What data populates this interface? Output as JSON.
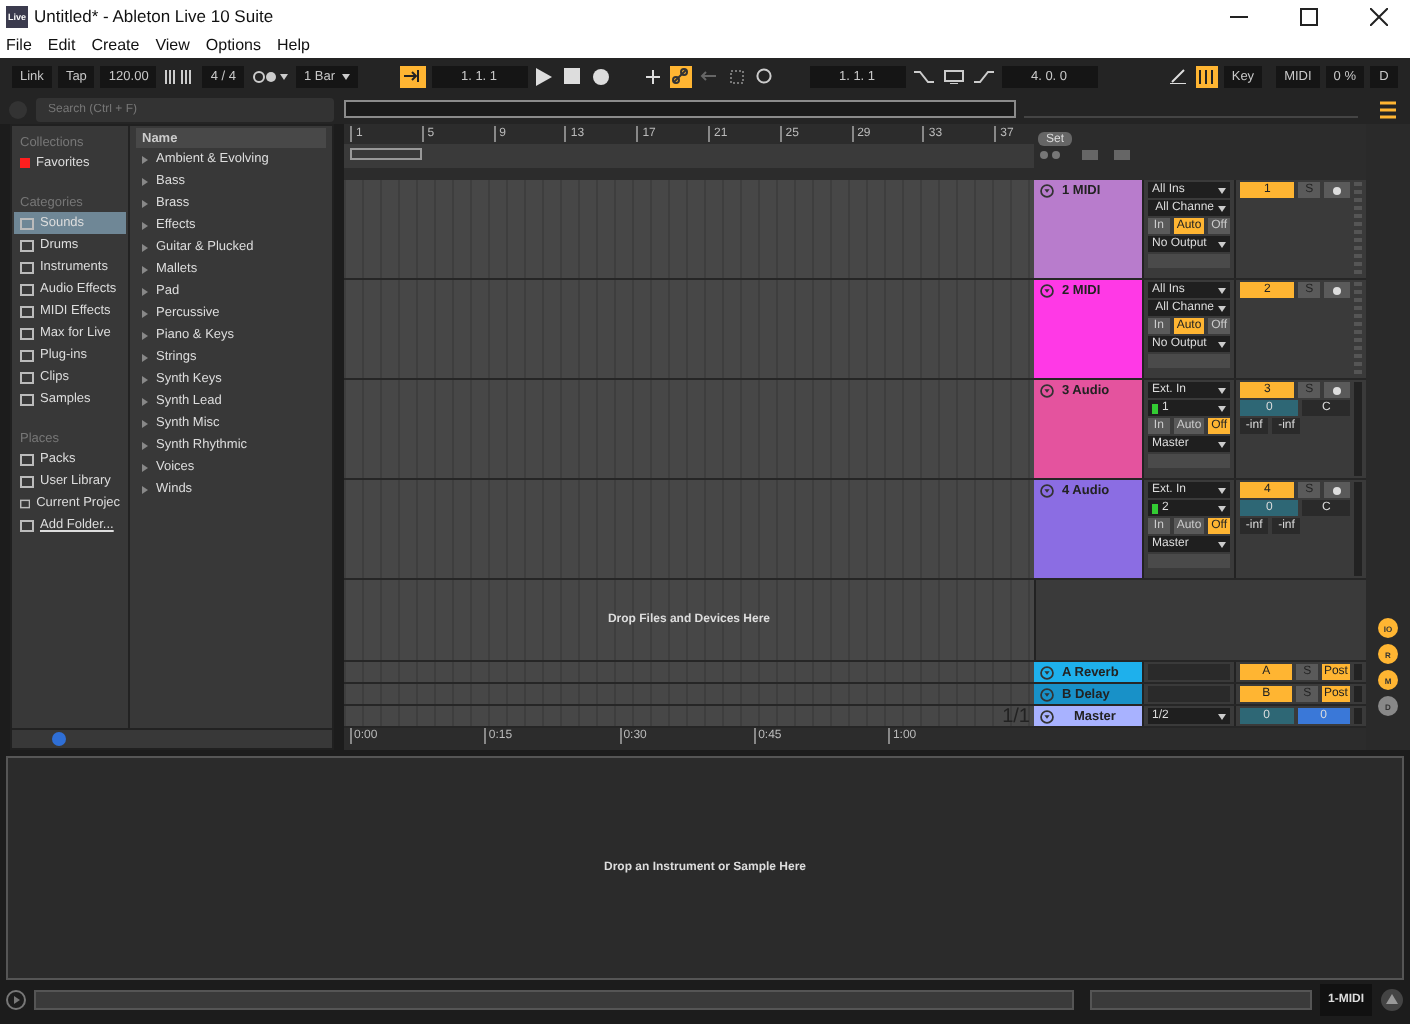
{
  "window": {
    "app_icon_text": "Live",
    "title": "Untitled* - Ableton Live 10 Suite"
  },
  "menu": [
    "File",
    "Edit",
    "Create",
    "View",
    "Options",
    "Help"
  ],
  "control_bar": {
    "link": "Link",
    "tap": "Tap",
    "tempo": "120.00",
    "signature": "4 / 4",
    "quantization": "1 Bar",
    "follow_on": true,
    "position": "1. 1. 1",
    "automation_arm_on": true,
    "loop_start": "1. 1. 1",
    "loop_length": "4. 0. 0",
    "key_map_on": true,
    "key": "Key",
    "midi": "MIDI",
    "cpu": "0 %",
    "disk": "D"
  },
  "browser": {
    "search": {
      "placeholder": "Search (Ctrl + F)"
    },
    "collections_heading": "Collections",
    "collections": [
      {
        "label": "Favorites",
        "color": "#ff1e1e"
      }
    ],
    "categories_heading": "Categories",
    "categories": [
      {
        "label": "Sounds",
        "selected": true
      },
      {
        "label": "Drums",
        "selected": false
      },
      {
        "label": "Instruments",
        "selected": false
      },
      {
        "label": "Audio Effects",
        "selected": false
      },
      {
        "label": "MIDI Effects",
        "selected": false
      },
      {
        "label": "Max for Live",
        "selected": false
      },
      {
        "label": "Plug-ins",
        "selected": false
      },
      {
        "label": "Clips",
        "selected": false
      },
      {
        "label": "Samples",
        "selected": false
      }
    ],
    "places_heading": "Places",
    "places": [
      "Packs",
      "User Library",
      "Current Projec",
      "Add Folder..."
    ],
    "name_heading": "Name",
    "names": [
      "Ambient & Evolving",
      "Bass",
      "Brass",
      "Effects",
      "Guitar & Plucked",
      "Mallets",
      "Pad",
      "Percussive",
      "Piano & Keys",
      "Strings",
      "Synth Keys",
      "Synth Lead",
      "Synth Misc",
      "Synth Rhythmic",
      "Voices",
      "Winds"
    ]
  },
  "arrangement": {
    "bar_ruler": [
      "1",
      "5",
      "9",
      "13",
      "17",
      "21",
      "25",
      "29",
      "33",
      "37"
    ],
    "time_ruler": [
      "0:00",
      "0:15",
      "0:30",
      "0:45",
      "1:00"
    ],
    "drop_text": "Drop Files and Devices Here",
    "zoom": "1/1",
    "set_label": "Set"
  },
  "tracks": [
    {
      "kind": "midi",
      "name": "1 MIDI",
      "color": "#b87ccc",
      "input": "All Ins",
      "channel": "All Channe",
      "monitor": [
        {
          "label": "In",
          "selected": false
        },
        {
          "label": "Auto",
          "selected": true
        },
        {
          "label": "Off",
          "selected": false
        }
      ],
      "output": "No Output",
      "number": "1",
      "solo": "S"
    },
    {
      "kind": "midi",
      "name": "2 MIDI",
      "color": "#ff39e6",
      "input": "All Ins",
      "channel": "All Channe",
      "monitor": [
        {
          "label": "In",
          "selected": false
        },
        {
          "label": "Auto",
          "selected": true
        },
        {
          "label": "Off",
          "selected": false
        }
      ],
      "output": "No Output",
      "number": "2",
      "solo": "S"
    },
    {
      "kind": "audio",
      "name": "3 Audio",
      "color": "#e4539e",
      "input": "Ext. In",
      "channel": "1",
      "monitor": [
        {
          "label": "In",
          "selected": false
        },
        {
          "label": "Auto",
          "selected": false
        },
        {
          "label": "Off",
          "selected": true
        }
      ],
      "output": "Master",
      "number": "3",
      "solo": "S",
      "volume": "0",
      "pan": "C",
      "meter_left": "-inf",
      "meter_right": "-inf"
    },
    {
      "kind": "audio",
      "name": "4 Audio",
      "color": "#8b6de3",
      "input": "Ext. In",
      "channel": "2",
      "monitor": [
        {
          "label": "In",
          "selected": false
        },
        {
          "label": "Auto",
          "selected": false
        },
        {
          "label": "Off",
          "selected": true
        }
      ],
      "output": "Master",
      "number": "4",
      "solo": "S",
      "volume": "0",
      "pan": "C",
      "meter_left": "-inf",
      "meter_right": "-inf"
    }
  ],
  "returns": [
    {
      "name": "A Reverb",
      "color": "#1eb0ec",
      "send": "A",
      "solo": "S",
      "post": "Post"
    },
    {
      "name": "B Delay",
      "color": "#1891c8",
      "send": "B",
      "solo": "S",
      "post": "Post"
    }
  ],
  "master": {
    "name": "Master",
    "color": "#a8b2ff",
    "cue": "1/2",
    "volume": "0",
    "pan": "0"
  },
  "view_switches": [
    {
      "label": "IO",
      "on": true
    },
    {
      "label": "R",
      "on": true
    },
    {
      "label": "M",
      "on": true
    },
    {
      "label": "D",
      "on": false
    }
  ],
  "detail": {
    "drop_text": "Drop an Instrument or Sample Here"
  },
  "status_bar": {
    "selected_track": "1-MIDI"
  }
}
